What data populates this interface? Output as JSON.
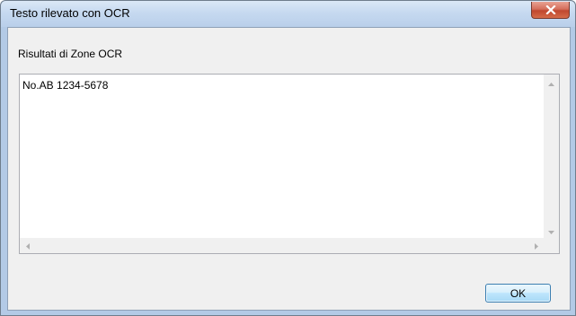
{
  "window": {
    "title": "Testo rilevato con OCR",
    "close_icon": "close-icon"
  },
  "group": {
    "label": "Risultati di Zone OCR"
  },
  "result_text": {
    "value": "No.AB 1234-5678"
  },
  "scrollbars": {
    "up_icon": "arrow-up-icon",
    "down_icon": "arrow-down-icon",
    "left_icon": "arrow-left-icon",
    "right_icon": "arrow-right-icon"
  },
  "buttons": {
    "ok_label": "OK"
  },
  "colors": {
    "title_bar": "#c6d9f0",
    "close_button": "#c0472f",
    "ok_border": "#3c7fb1"
  }
}
